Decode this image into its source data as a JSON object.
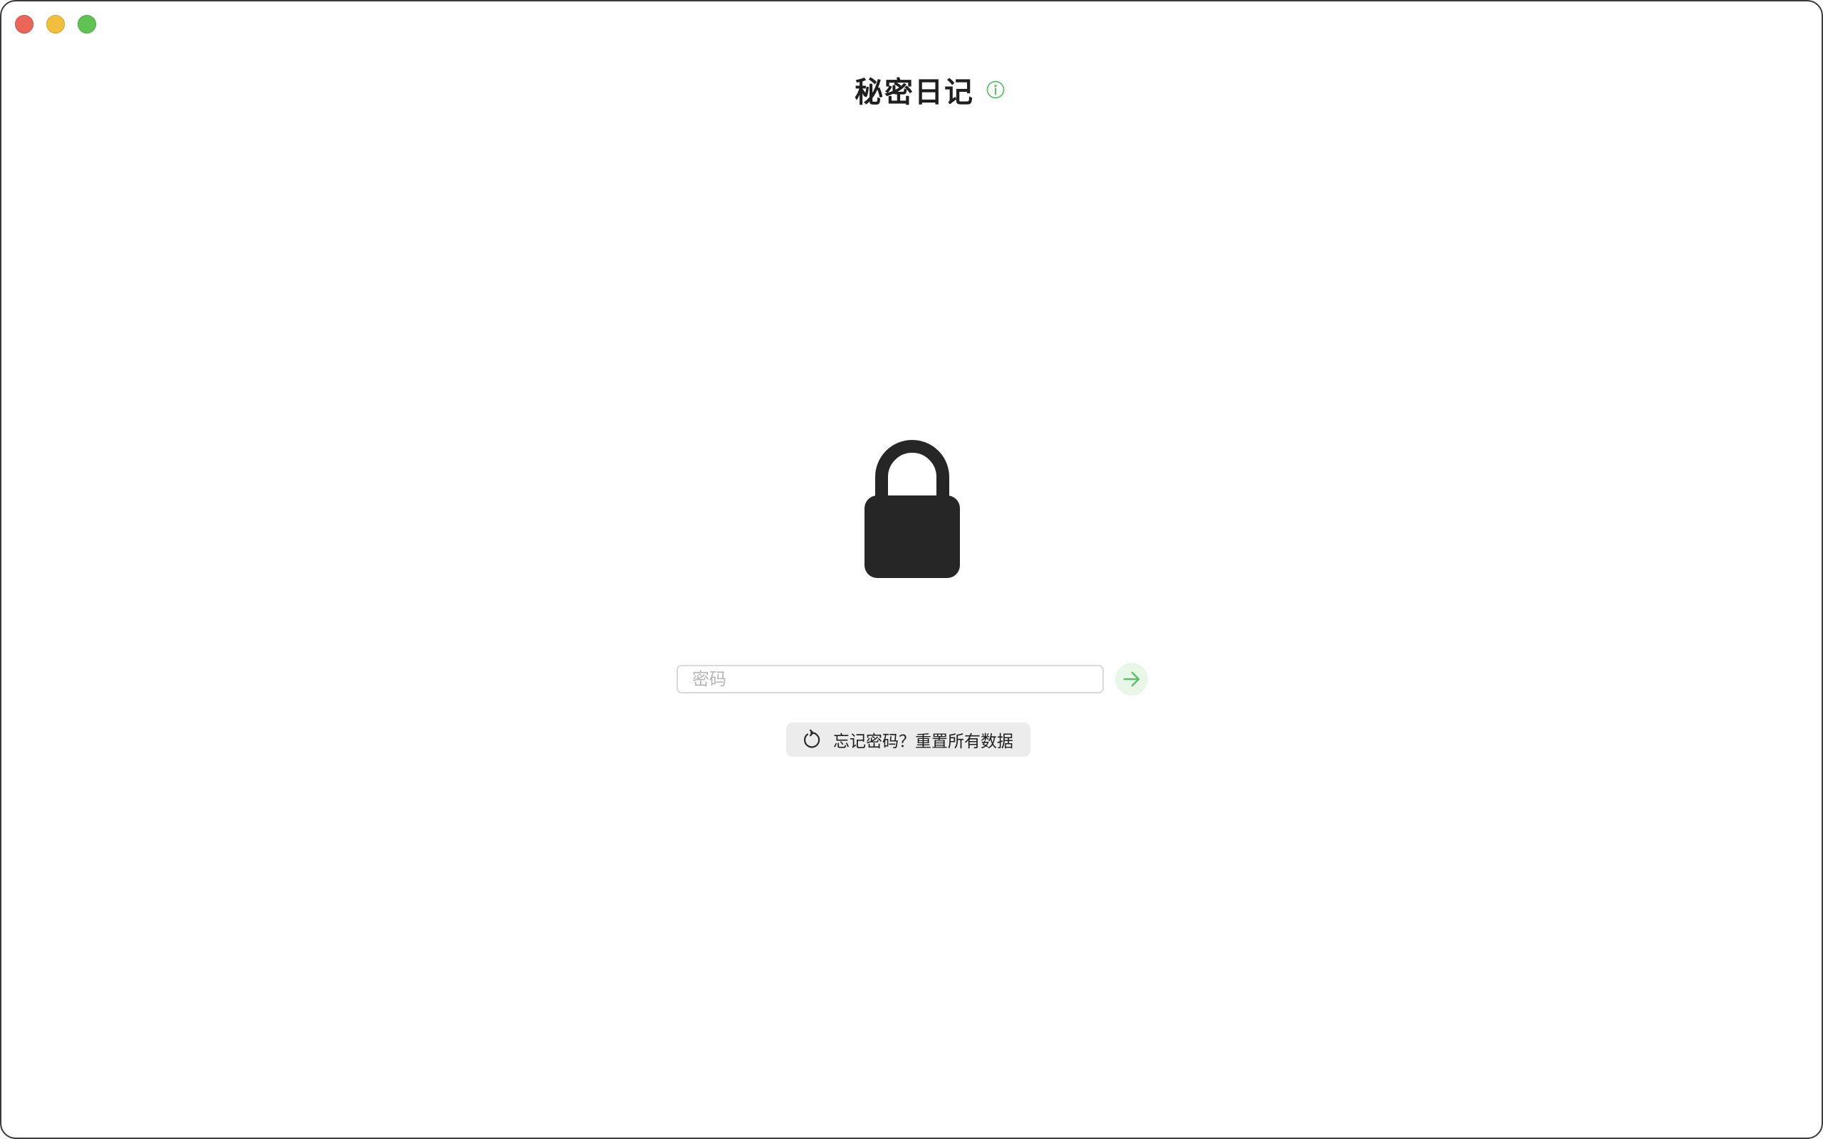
{
  "window": {
    "controls": [
      "close",
      "minimize",
      "zoom"
    ]
  },
  "header": {
    "title": "秘密日记",
    "info_icon": "info-circle-icon"
  },
  "lock": {
    "icon": "lock-icon"
  },
  "password": {
    "placeholder": "密码",
    "value": "",
    "submit_icon": "arrow-right-icon"
  },
  "reset": {
    "label": "忘记密码？重置所有数据",
    "icon": "reset-arrow-icon"
  },
  "colors": {
    "accent": "#5fc066",
    "accent_bg": "#e8f6e8",
    "lock": "#262626",
    "button_bg": "#ececec"
  }
}
